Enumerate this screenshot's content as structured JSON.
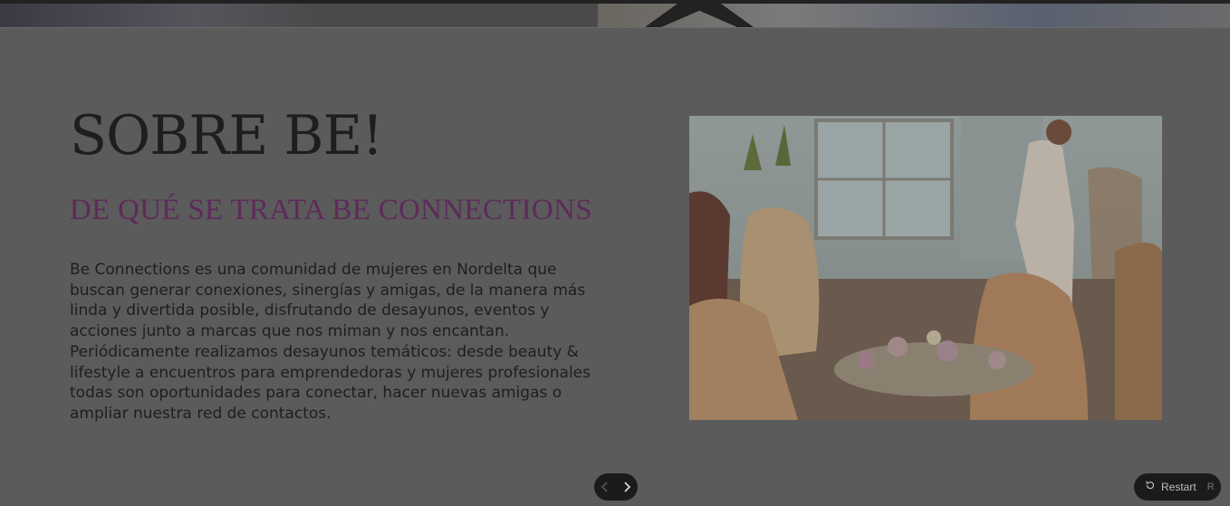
{
  "hero": {
    "title": "SOBRE BE!",
    "subtitle": "DE QUÉ SE TRATA BE CONNECTIONS",
    "description": "Be Connections es una comunidad de mujeres en Nordelta que buscan generar conexiones, sinergías y amigas, de la manera más linda y divertida posible, disfrutando de desayunos, eventos y acciones junto a marcas que nos miman y nos encantan. Periódicamente realizamos desayunos temáticos: desde beauty & lifestyle a encuentros para emprendedoras y mujeres profesionales todas son oportunidades para conectar, hacer nuevas amigas o ampliar nuestra red de contactos."
  },
  "nav": {
    "prev_icon": "chevron-left-icon",
    "next_icon": "chevron-right-icon"
  },
  "restart": {
    "label": "Restart",
    "shortcut": "R",
    "icon": "restart-icon"
  },
  "colors": {
    "overlay": "#5b5b5b",
    "subtitle": "#5e2a5a",
    "text": "#1e1e1e",
    "pill": "#1b1b1b"
  }
}
